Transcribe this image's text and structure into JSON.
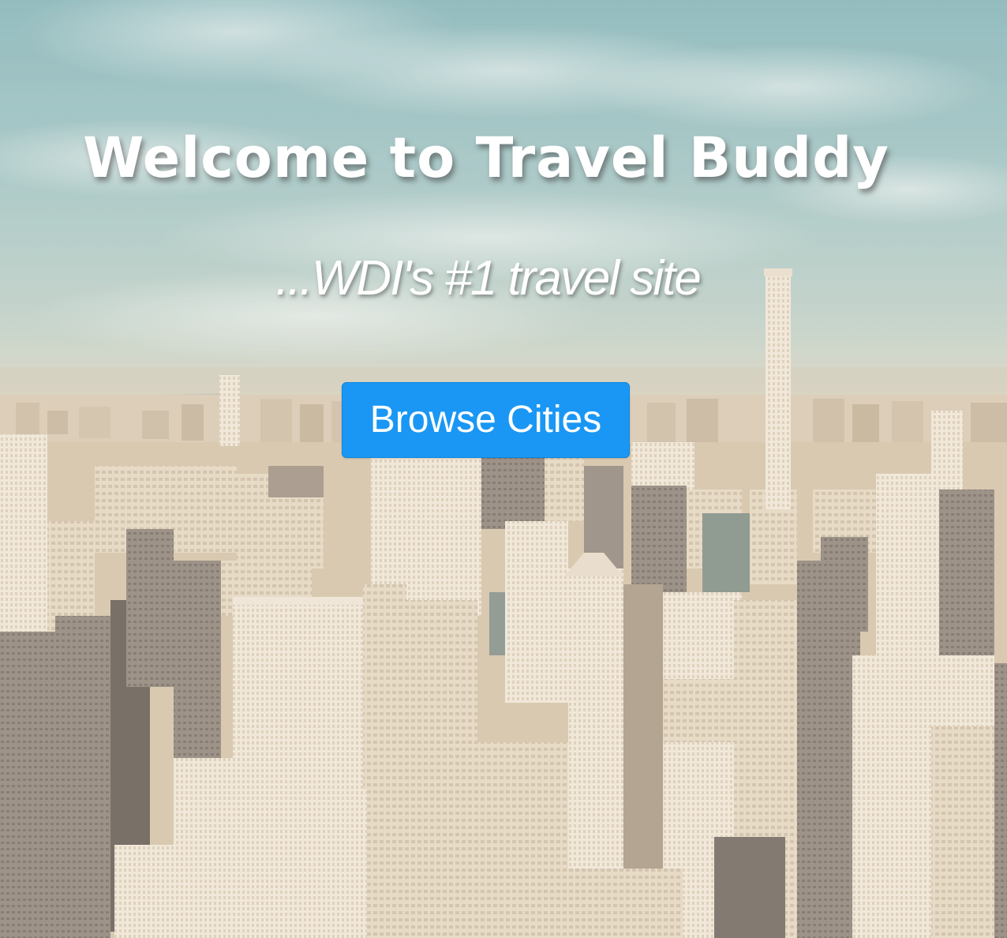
{
  "hero": {
    "title": "Welcome to Travel Buddy",
    "subtitle": "...WDI's #1 travel site",
    "cta_label": "Browse Cities",
    "background_image": "city-skyline-photo"
  },
  "colors": {
    "cta_background": "#1a97f4",
    "cta_text": "#ffffff",
    "heading_text": "#ffffff",
    "sky": "#8fbfc6",
    "city": "#d8c6ad"
  }
}
